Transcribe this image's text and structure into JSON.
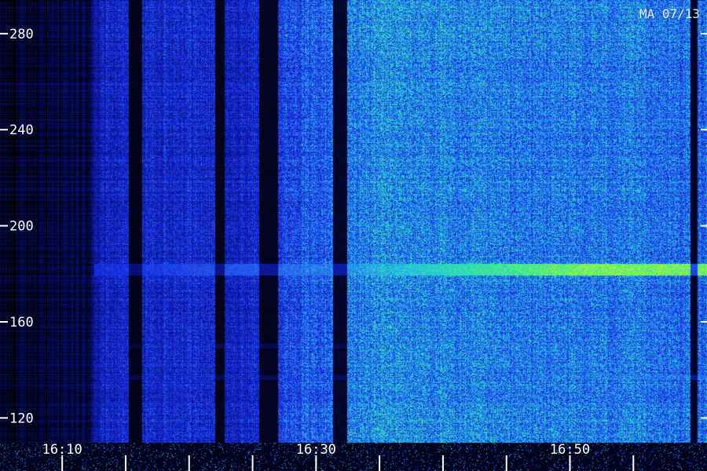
{
  "chart_data": {
    "type": "heatmap",
    "title": "",
    "xlabel": "",
    "ylabel": "",
    "stamp": "MA 07/13",
    "y_ticks": [
      {
        "value": 280,
        "label": "280"
      },
      {
        "value": 240,
        "label": "240"
      },
      {
        "value": 200,
        "label": "200"
      },
      {
        "value": 160,
        "label": "160"
      },
      {
        "value": 120,
        "label": "120"
      }
    ],
    "ylim": [
      110,
      294
    ],
    "x_labels": [
      {
        "minute": 10,
        "label": "16:10"
      },
      {
        "minute": 30,
        "label": "16:30"
      },
      {
        "minute": 50,
        "label": "16:50"
      }
    ],
    "x_minor_tick_minutes": [
      5,
      10,
      15,
      20,
      25,
      30,
      35,
      40,
      45,
      50,
      55
    ],
    "xlim_minutes": [
      5.1,
      60.8
    ],
    "colormap": [
      "#000000",
      "#08107a",
      "#1628e0",
      "#2a6cf0",
      "#22c8e0",
      "#3cf08a",
      "#c8f020"
    ],
    "emission_bands": [
      {
        "y": 182,
        "start_minute": 12.5,
        "end_minute": 60.8,
        "intensity": [
          0.35,
          0.45,
          0.55,
          0.8,
          0.95,
          0.95
        ]
      },
      {
        "y": 150,
        "start_minute": 12.5,
        "end_minute": 60.8,
        "intensity": [
          0.15,
          0.25,
          0.25,
          0.22,
          0.2,
          0.2
        ]
      },
      {
        "y": 137,
        "start_minute": 12.5,
        "end_minute": 60.8,
        "intensity": [
          0.2,
          0.25,
          0.3,
          0.35,
          0.45,
          0.5
        ]
      }
    ],
    "data_gaps_minutes": [
      {
        "start": 15.2,
        "end": 16.3
      },
      {
        "start": 22.0,
        "end": 22.8
      },
      {
        "start": 25.5,
        "end": 27.0
      },
      {
        "start": 31.3,
        "end": 32.4
      },
      {
        "start": 59.5,
        "end": 60.0
      }
    ],
    "background_level": [
      {
        "minute": 5.1,
        "level": 0.05
      },
      {
        "minute": 12.0,
        "level": 0.1
      },
      {
        "minute": 13.0,
        "level": 0.3
      },
      {
        "minute": 20.0,
        "level": 0.35
      },
      {
        "minute": 24.0,
        "level": 0.3
      },
      {
        "minute": 28.0,
        "level": 0.45
      },
      {
        "minute": 35.0,
        "level": 0.6
      },
      {
        "minute": 45.0,
        "level": 0.55
      },
      {
        "minute": 55.0,
        "level": 0.55
      },
      {
        "minute": 60.8,
        "level": 0.5
      }
    ]
  }
}
